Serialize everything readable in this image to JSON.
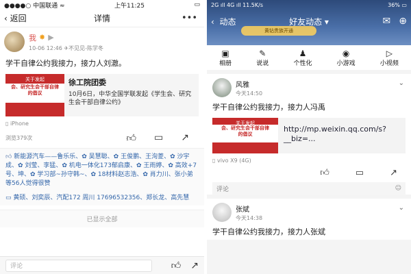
{
  "left": {
    "status": {
      "carrier": "●●●●○ 中国联通 ≈",
      "time": "上午11:25",
      "battery": "▭"
    },
    "nav": {
      "back_label": "返回",
      "title": "详情",
      "more": "•••"
    },
    "post": {
      "name": "我",
      "meta": "10-06 12:46  ✈不见见-陈学冬",
      "text": "学干自律公约我接力，接力人刘澈。",
      "share_title": "徐工院团委",
      "share_desc": "10月6日，中华全国学联发起《学生会、研究生会干部自律公约》",
      "thumb_top": "关于发起",
      "thumb_band": "会、研究生会干部自律\n的倡议",
      "device": "iPhone",
      "views": "浏览379次"
    },
    "likes_text": "新能源汽车——鲁乐乐、✿ 吴慧聪、✿ 王俊鹏、王洵菱、✿ 沙宇成、✿ 刘莹、李猛、✿ 机电一体化173郁启康、✿ 王雨婷、✿ 高效+7号、坤、✿ 学习部~孙守韩~、✿ 18材料赵志浩、✿ 肖力川、张小弟等56人觉得很赞",
    "comment_line": "黄硕、刘奕辰、汽配172 周川 17696532356、郑长龙、高先慧",
    "shown_all": "已显示全部",
    "comment_placeholder": "评论"
  },
  "right": {
    "status": {
      "left": "2G ıll 4G ıll 11.5K/s",
      "right": "36% ▭"
    },
    "nav": {
      "back_label": "动态",
      "title": "好友动态 ▾"
    },
    "vip": "黄钻贵族开通",
    "tabs": [
      {
        "icon": "▣",
        "label": "相册"
      },
      {
        "icon": "✎",
        "label": "说说"
      },
      {
        "icon": "♟",
        "label": "个性化"
      },
      {
        "icon": "◉",
        "label": "小游戏"
      },
      {
        "icon": "▷",
        "label": "小视频"
      }
    ],
    "cards": [
      {
        "name": "风雅",
        "time": "今天14:50",
        "text": "学干自律公约我接力，接力人冯禹",
        "url": "http://mp.weixin.qq.com/s?__biz=...",
        "thumb_top": "关于发起",
        "thumb_band": "会、研究生会干部自律\n的倡议",
        "device": "vivo X9 (4G)",
        "comment_placeholder": "评论"
      },
      {
        "name": "张斌",
        "time": "今天14:38",
        "text": "学干自律公约我接力，接力人张斌"
      }
    ]
  }
}
